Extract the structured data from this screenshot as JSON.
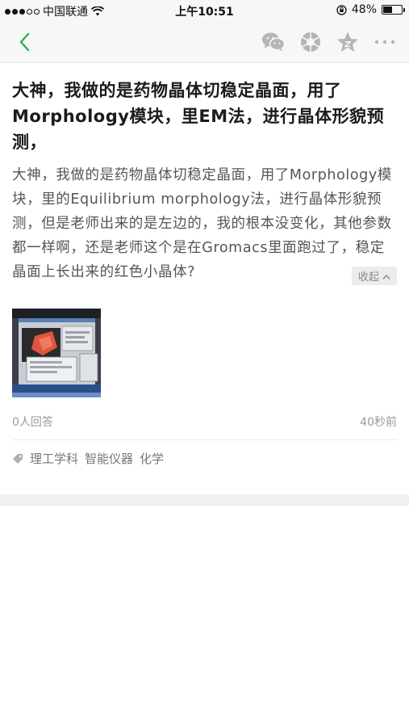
{
  "status_bar": {
    "carrier": "中国联通",
    "time": "上午10:51",
    "battery_percent": "48%",
    "battery_level": 0.48
  },
  "nav": {
    "back_icon": "chevron-left-icon",
    "icons": [
      "wechat-icon",
      "moments-icon",
      "star-icon",
      "more-icon"
    ],
    "accent_color": "#2bb24c"
  },
  "question": {
    "title": "大神，我做的是药物晶体切稳定晶面，用了Morphology模块，里EM法，进行晶体形貌预测，",
    "body": "大神，我做的是药物晶体切稳定晶面，用了Morphology模块，里的Equilibrium morphology法，进行晶体形貌预测，但是老师出来的是左边的，我的根本没变化，其他参数都一样啊，还是老师这个是在Gromacs里面跑过了，稳定晶面上长出来的红色小晶体?",
    "collapse_label": "收起",
    "answers": "0人回答",
    "time_ago": "40秒前",
    "tags": [
      "理工学科",
      "智能仪器",
      "化学"
    ]
  }
}
